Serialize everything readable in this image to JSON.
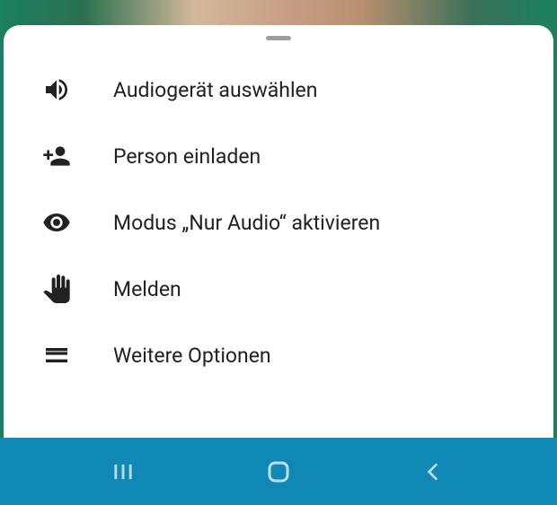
{
  "menu": {
    "items": [
      {
        "label": "Audiogerät auswählen"
      },
      {
        "label": "Person einladen"
      },
      {
        "label": "Modus „Nur Audio“ aktivieren"
      },
      {
        "label": "Melden"
      },
      {
        "label": "Weitere Optionen"
      }
    ]
  }
}
